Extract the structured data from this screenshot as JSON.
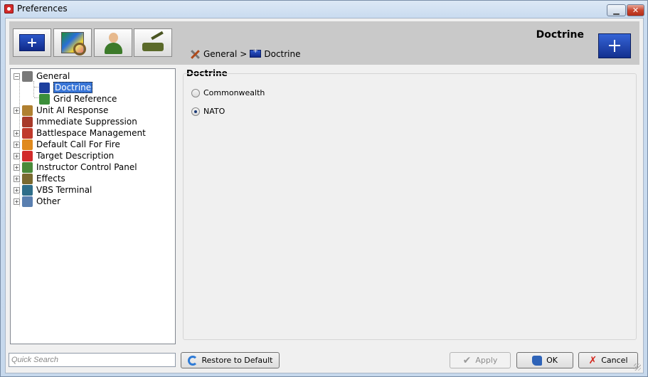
{
  "window": {
    "title": "Preferences",
    "minimize_icon": "minimize-icon",
    "close_icon": "close-icon"
  },
  "toolbar": {
    "buttons": [
      {
        "icon": "flag-icon"
      },
      {
        "icon": "map-magnifier-icon"
      },
      {
        "icon": "person-icon"
      },
      {
        "icon": "tank-icon"
      }
    ]
  },
  "header": {
    "title": "Doctrine",
    "breadcrumb": {
      "root": "General",
      "separator": ">",
      "current": "Doctrine"
    }
  },
  "tree": {
    "items": [
      {
        "label": "General",
        "expander": "−",
        "icon": "tools-icon",
        "color": "#7a7a7a"
      },
      {
        "label": "Doctrine",
        "expander": "",
        "icon": "flag-icon",
        "color": "#1d3f9e",
        "selected": true
      },
      {
        "label": "Grid Reference",
        "expander": "",
        "icon": "map-icon",
        "color": "#3b8f3a"
      },
      {
        "label": "Unit AI Response",
        "expander": "+",
        "icon": "ai-icon",
        "color": "#b08030"
      },
      {
        "label": "Immediate Suppression",
        "expander": "",
        "icon": "suppression-icon",
        "color": "#a83a2a"
      },
      {
        "label": "Battlespace Management",
        "expander": "+",
        "icon": "battlespace-icon",
        "color": "#c0392b"
      },
      {
        "label": "Default Call For Fire",
        "expander": "+",
        "icon": "fire-icon",
        "color": "#e08a1e"
      },
      {
        "label": "Target Description",
        "expander": "+",
        "icon": "target-icon",
        "color": "#d12b2b"
      },
      {
        "label": "Instructor Control Panel",
        "expander": "+",
        "icon": "instructor-icon",
        "color": "#4a8a3a"
      },
      {
        "label": "Effects",
        "expander": "+",
        "icon": "effects-icon",
        "color": "#7a6a30"
      },
      {
        "label": "VBS Terminal",
        "expander": "+",
        "icon": "terminal-icon",
        "color": "#2f6e8a"
      },
      {
        "label": "Other",
        "expander": "+",
        "icon": "other-icon",
        "color": "#5a7fb0"
      }
    ]
  },
  "panel": {
    "title": "Doctrine",
    "options": [
      {
        "label": "Commonwealth",
        "checked": false
      },
      {
        "label": "NATO",
        "checked": true
      }
    ]
  },
  "search": {
    "placeholder": "Quick Search",
    "value": ""
  },
  "buttons": {
    "restore": "Restore to Default",
    "apply": "Apply",
    "ok": "OK",
    "cancel": "Cancel"
  },
  "colors": {
    "selection": "#3875d7",
    "titlebar": "#c9dbef",
    "close_button": "#c9452e"
  }
}
